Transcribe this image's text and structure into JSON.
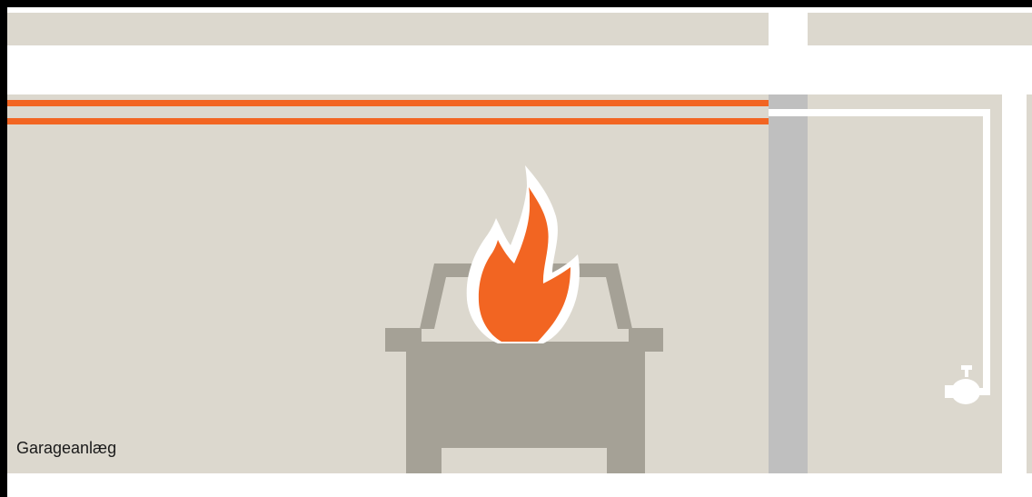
{
  "label": {
    "area_name": "Garageanlæg"
  },
  "colors": {
    "frame": "#000000",
    "background": "#ffffff",
    "wall_beige": "#dcd8ce",
    "column_gray": "#bfbfbf",
    "car_gray": "#a5a196",
    "fire_orange": "#f26522",
    "flame_outline": "#ffffff",
    "pipe_white": "#ffffff"
  },
  "icons": {
    "fire": "fire-icon",
    "car": "car-icon",
    "valve": "faucet-valve-icon"
  }
}
